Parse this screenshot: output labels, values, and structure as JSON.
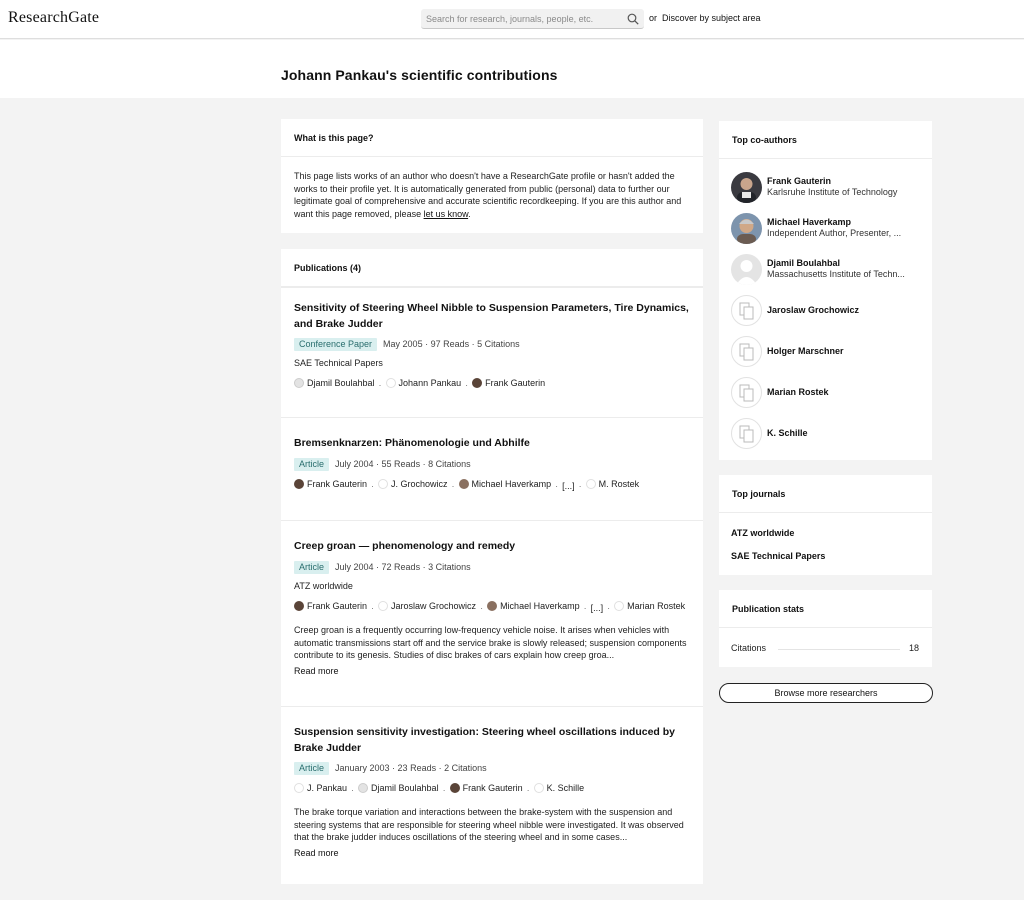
{
  "header": {
    "logo": "ResearchGate",
    "search_placeholder": "Search for research, journals, people, etc.",
    "or_text": "or",
    "discover_link": "Discover by subject area"
  },
  "page": {
    "title": "Johann Pankau's scientific contributions"
  },
  "what_card": {
    "heading": "What is this page?",
    "body": "This page lists works of an author who doesn't have a ResearchGate profile or hasn't added the works to their profile yet. It is automatically generated from public (personal) data to further our legitimate goal of comprehensive and accurate scientific recordkeeping. If you are this author and want this page removed, please ",
    "link": "let us know",
    "end": "."
  },
  "publications": {
    "heading": "Publications (4)",
    "items": [
      {
        "title": "Sensitivity of Steering Wheel Nibble to Suspension Parameters, Tire Dynamics, and Brake Judder",
        "type": "Conference Paper",
        "meta": "May 2005 · 97 Reads · 5 Citations",
        "venue": "SAE Technical Papers",
        "authors": [
          "Djamil Boulahbal",
          "Johann Pankau",
          "Frank Gauterin"
        ]
      },
      {
        "title": "Bremsenknarzen: Phänomenologie und Abhilfe",
        "type": "Article",
        "meta": "July 2004 · 55 Reads · 8 Citations",
        "authors": [
          "Frank Gauterin",
          "J. Grochowicz",
          "Michael Haverkamp",
          "[...]",
          "M. Rostek"
        ]
      },
      {
        "title": "Creep groan — phenomenology and remedy",
        "type": "Article",
        "meta": "July 2004 · 72 Reads · 3 Citations",
        "venue": "ATZ worldwide",
        "authors": [
          "Frank Gauterin",
          "Jaroslaw Grochowicz",
          "Michael Haverkamp",
          "[...]",
          "Marian Rostek"
        ],
        "abstract": "Creep groan is a frequently occurring low-frequency vehicle noise. It arises when vehicles with automatic transmissions start off and the service brake is slowly released; suspension components contribute to its genesis. Studies of disc brakes of cars explain how creep groa...",
        "read_more": "Read more"
      },
      {
        "title": "Suspension sensitivity investigation: Steering wheel oscillations induced by Brake Judder",
        "type": "Article",
        "meta": "January 2003 · 23 Reads · 2 Citations",
        "authors": [
          "J. Pankau",
          "Djamil Boulahbal",
          "Frank Gauterin",
          "K. Schille"
        ],
        "abstract": "The brake torque variation and interactions between the brake-system with the suspension and steering systems that are responsible for steering wheel nibble were investigated. It was observed that the brake judder induces oscillations of the steering wheel and in some cases...",
        "read_more": "Read more"
      }
    ]
  },
  "coauthors": {
    "heading": "Top co-authors",
    "items": [
      {
        "name": "Frank Gauterin",
        "affiliation": "Karlsruhe Institute of Technology"
      },
      {
        "name": "Michael Haverkamp",
        "affiliation": "Independent Author, Presenter, ..."
      },
      {
        "name": "Djamil Boulahbal",
        "affiliation": "Massachusetts Institute of Techn..."
      },
      {
        "name": "Jaroslaw Grochowicz"
      },
      {
        "name": "Holger Marschner"
      },
      {
        "name": "Marian Rostek"
      },
      {
        "name": "K. Schille"
      }
    ]
  },
  "journals": {
    "heading": "Top journals",
    "items": [
      "ATZ worldwide",
      "SAE Technical Papers"
    ]
  },
  "stats": {
    "heading": "Publication stats",
    "citations_label": "Citations",
    "citations_value": "18"
  },
  "browse_button": "Browse more researchers"
}
